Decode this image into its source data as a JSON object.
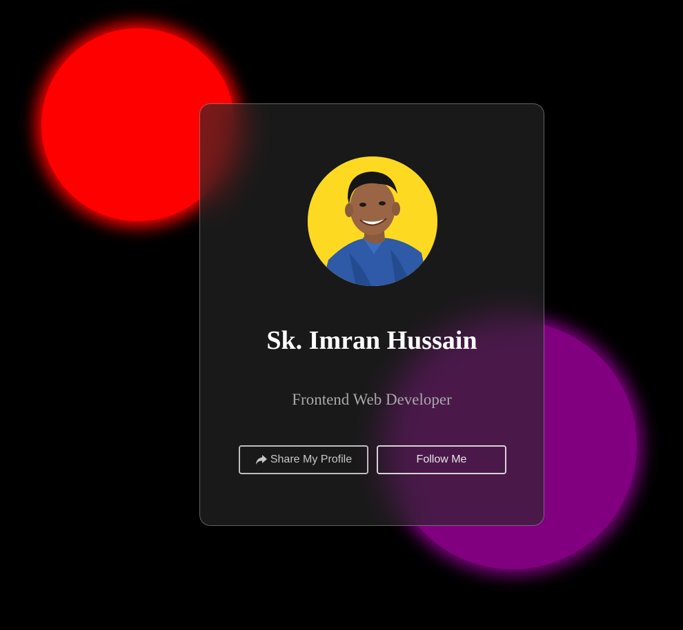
{
  "profile": {
    "name": "Sk. Imran Hussain",
    "role": "Frontend Web Developer",
    "avatar_alt": "profile photo"
  },
  "actions": {
    "share_label": "Share My Profile",
    "share_icon": "share-icon",
    "follow_label": "Follow Me"
  },
  "colors": {
    "background": "#000000",
    "red_blob": "#ff0000",
    "purple_blob": "#800080",
    "avatar_bg": "#fdd922",
    "name_text": "#ffffff",
    "role_text": "#a9a9a9"
  }
}
